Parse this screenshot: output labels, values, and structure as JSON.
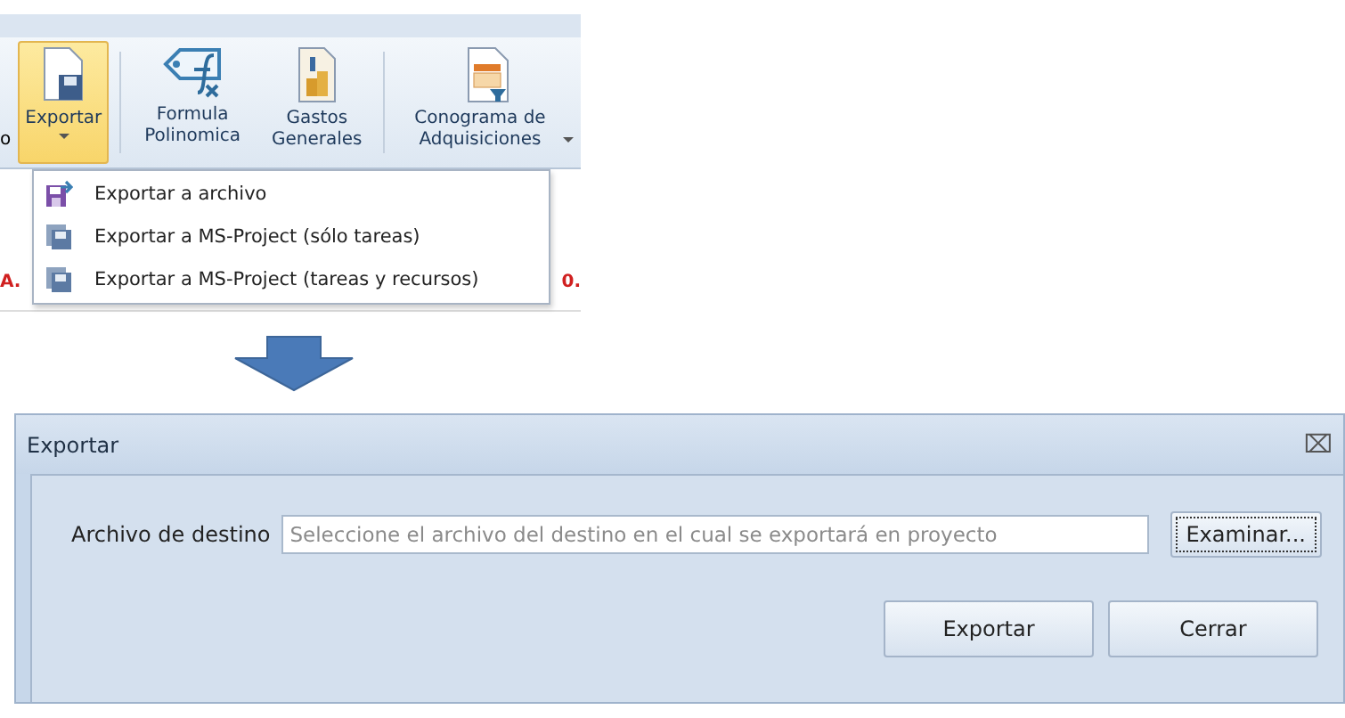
{
  "ribbon": {
    "fragment": "o",
    "buttons": [
      {
        "kind": "export",
        "label": "Exportar",
        "selected": true,
        "dropdown": true
      },
      {
        "kind": "formula",
        "label": "Formula Polinomica",
        "selected": false,
        "dropdown": false
      },
      {
        "kind": "costs",
        "label": "Gastos Generales",
        "selected": false,
        "dropdown": false
      },
      {
        "kind": "schedule",
        "label": "Conograma de Adquisiciones",
        "selected": false,
        "dropdown": true
      }
    ]
  },
  "sheet_fragments": [
    "A.",
    "0."
  ],
  "menu": {
    "items": [
      {
        "kind": "file",
        "label": "Exportar a archivo"
      },
      {
        "kind": "project",
        "label": "Exportar a MS-Project (sólo tareas)"
      },
      {
        "kind": "project",
        "label": "Exportar a MS-Project (tareas y recursos)"
      }
    ]
  },
  "dialog": {
    "title": "Exportar",
    "close": "⌧",
    "field_label": "Archivo de destino",
    "field": {
      "placeholder": "Seleccione el archivo del destino en el cual se exportará en proyecto"
    },
    "browse": "Examinar...",
    "buttons": [
      "Exportar",
      "Cerrar"
    ]
  }
}
